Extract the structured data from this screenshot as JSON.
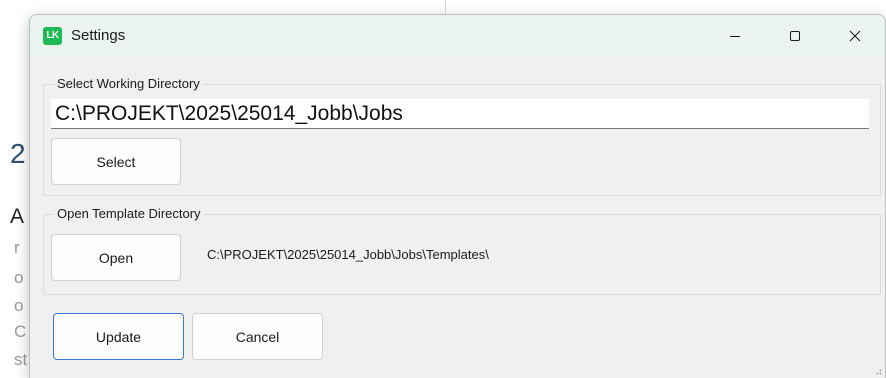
{
  "background": {
    "heading_fragment": "2",
    "paragraph_fragment": "A",
    "side_fragments": [
      "r",
      "o",
      "o",
      "C",
      "st"
    ]
  },
  "window": {
    "app_logo": "LK",
    "title": "Settings",
    "controls": {
      "minimize_icon": "minimize-icon",
      "maximize_icon": "maximize-icon",
      "close_icon": "close-icon"
    }
  },
  "working_directory": {
    "group_label": "Select Working Directory",
    "path_value": "C:\\PROJEKT\\2025\\25014_Jobb\\Jobs",
    "select_button": "Select"
  },
  "template_directory": {
    "group_label": "Open Template Directory",
    "open_button": "Open",
    "path": "C:\\PROJEKT\\2025\\25014_Jobb\\Jobs\\Templates\\"
  },
  "actions": {
    "update_button": "Update",
    "cancel_button": "Cancel"
  },
  "colors": {
    "accent": "#3b78d4",
    "logo": "#1db954",
    "titlebar": "#eaf3ee",
    "dialog_bg": "#f0f0f0"
  }
}
